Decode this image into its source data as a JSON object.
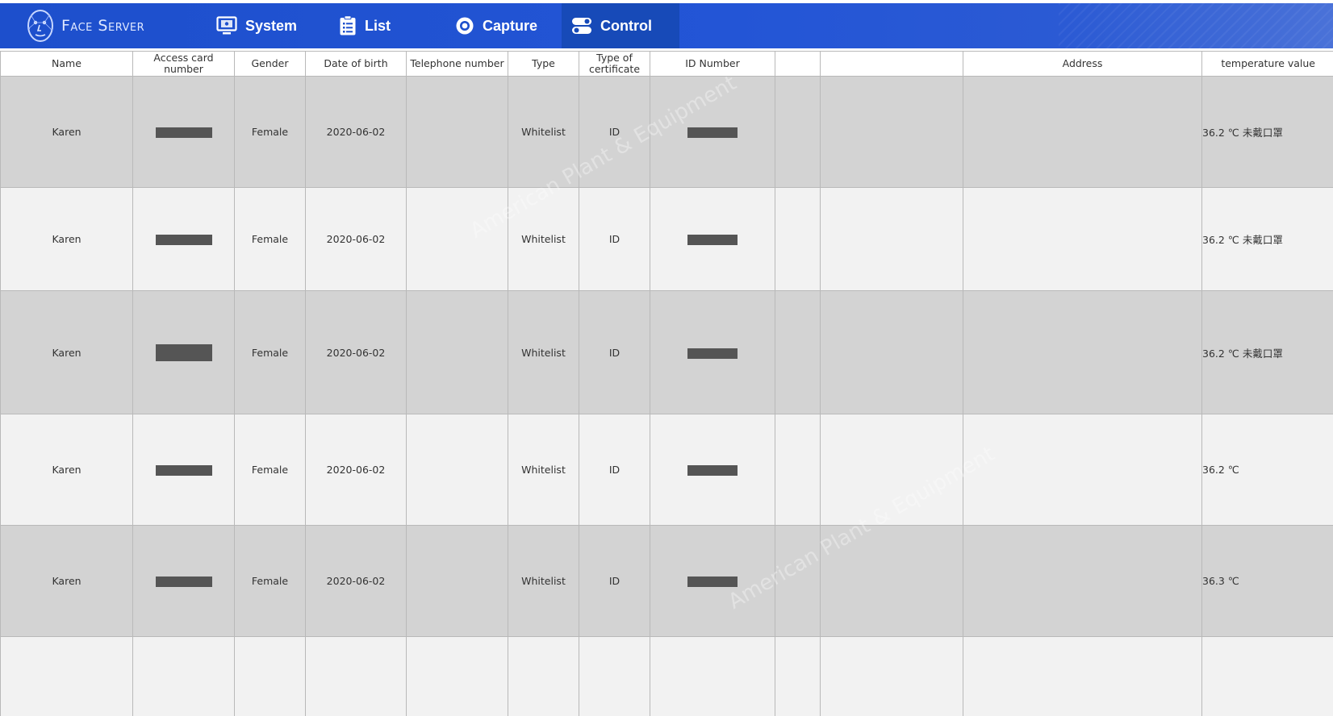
{
  "app": {
    "brand": "Face Server"
  },
  "nav": {
    "items": [
      {
        "label": "System",
        "icon": "monitor-icon"
      },
      {
        "label": "List",
        "icon": "clipboard-list-icon"
      },
      {
        "label": "Capture",
        "icon": "camera-icon"
      },
      {
        "label": "Control",
        "icon": "toggle-switch-icon",
        "active": true
      }
    ]
  },
  "table": {
    "columns": [
      "Name",
      "Access card number",
      "Gender",
      "Date of birth",
      "Telephone number",
      "Type",
      "Type of certificate",
      "ID Number",
      "",
      "",
      "Address",
      "temperature value"
    ],
    "rows": [
      {
        "name": "Karen",
        "access_card": "[redacted]",
        "gender": "Female",
        "dob": "2020-06-02",
        "phone": "",
        "type": "Whitelist",
        "cert_type": "ID",
        "id_number": "[redacted]",
        "extra1": "",
        "extra2": "",
        "address": "",
        "temperature": "36.2 ℃ 未戴口罩"
      },
      {
        "name": "Karen",
        "access_card": "[redacted]",
        "gender": "Female",
        "dob": "2020-06-02",
        "phone": "",
        "type": "Whitelist",
        "cert_type": "ID",
        "id_number": "[redacted]",
        "extra1": "",
        "extra2": "",
        "address": "",
        "temperature": "36.2 ℃ 未戴口罩"
      },
      {
        "name": "Karen",
        "access_card": "[redacted]",
        "gender": "Female",
        "dob": "2020-06-02",
        "phone": "",
        "type": "Whitelist",
        "cert_type": "ID",
        "id_number": "[redacted]",
        "extra1": "",
        "extra2": "",
        "address": "",
        "temperature": "36.2 ℃ 未戴口罩"
      },
      {
        "name": "Karen",
        "access_card": "[redacted]",
        "gender": "Female",
        "dob": "2020-06-02",
        "phone": "",
        "type": "Whitelist",
        "cert_type": "ID",
        "id_number": "[redacted]",
        "extra1": "",
        "extra2": "",
        "address": "",
        "temperature": "36.2 ℃"
      },
      {
        "name": "Karen",
        "access_card": "[redacted]",
        "gender": "Female",
        "dob": "2020-06-02",
        "phone": "",
        "type": "Whitelist",
        "cert_type": "ID",
        "id_number": "[redacted]",
        "extra1": "",
        "extra2": "",
        "address": "",
        "temperature": "36.3 ℃"
      },
      {
        "name": "",
        "access_card": "",
        "gender": "",
        "dob": "",
        "phone": "",
        "type": "",
        "cert_type": "",
        "id_number": "",
        "extra1": "",
        "extra2": "",
        "address": "",
        "temperature": ""
      }
    ]
  },
  "watermark": {
    "text": "American Plant & Equipment"
  },
  "colors": {
    "nav_bar": "#1d4fcc",
    "nav_active": "#174ab8",
    "row_dark": "#d3d3d3",
    "row_light": "#f2f2f2",
    "redaction": "#555555"
  }
}
